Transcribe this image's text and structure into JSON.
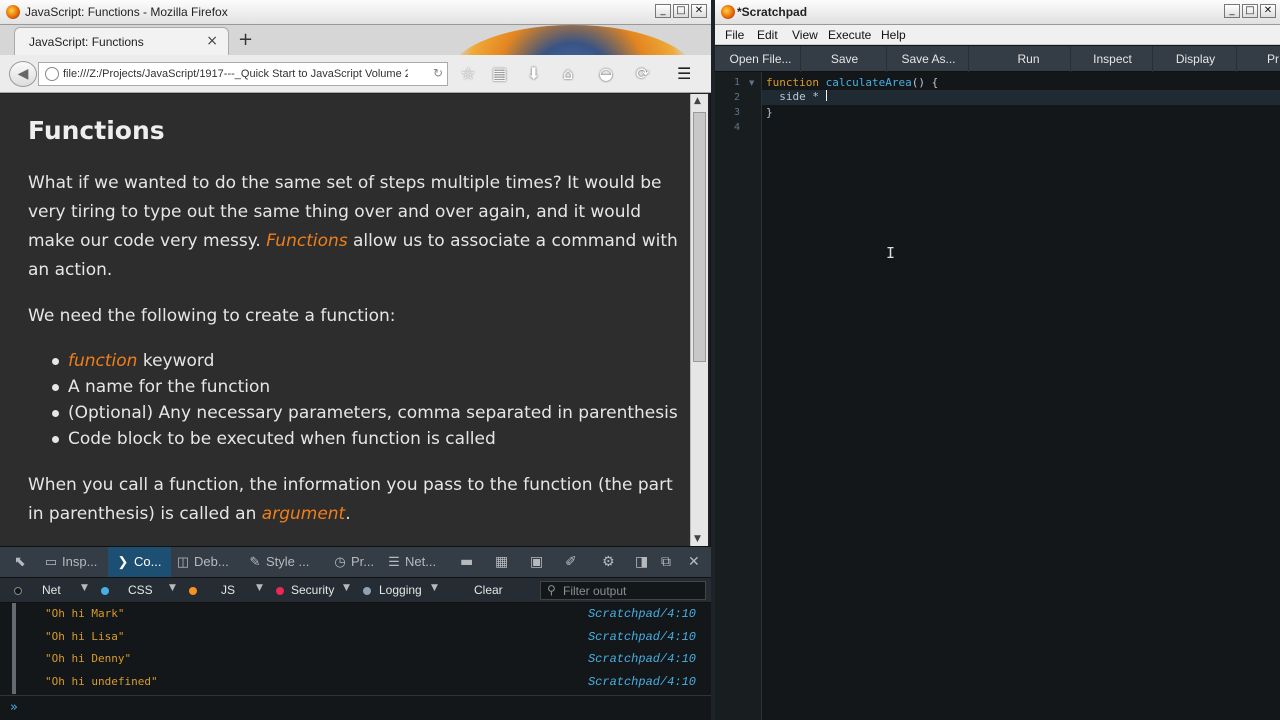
{
  "firefox": {
    "title": "JavaScript: Functions - Mozilla Firefox",
    "tab_label": "JavaScript: Functions",
    "tab_close": "×",
    "new_tab": "+",
    "url": "file:///Z:/Projects/JavaScript/1917---_Quick Start to JavaScript Volume 2",
    "win_min": "_",
    "win_max": "□",
    "win_close": "✕"
  },
  "content": {
    "heading": "Functions",
    "p1_a": "What if we wanted to do the same set of steps multiple times? It would be very tiring to type out the same thing over and over again, and it would make our code very messy. ",
    "p1_hl": "Functions",
    "p1_b": " allow us to associate a command with an action.",
    "p2": "We need the following to create a function:",
    "bullet1_hl": "function",
    "bullet1_rest": " keyword",
    "bullet2": "A name for the function",
    "bullet3": "(Optional) Any necessary parameters, comma separated in parenthesis",
    "bullet4": "Code block to be executed when function is called",
    "p3_a": "When you call a function, the information you pass to the function (the part in parenthesis) is called an ",
    "p3_hl": "argument",
    "p3_b": "."
  },
  "devtools": {
    "tabs": [
      "Insp...",
      "Co...",
      "Deb...",
      "Style ...",
      "Pr...",
      "Net..."
    ],
    "filters": {
      "net": "Net",
      "css": "CSS",
      "js": "JS",
      "security": "Security",
      "logging": "Logging",
      "clear": "Clear",
      "filter_placeholder": "Filter output"
    },
    "log": [
      {
        "msg": "\"Oh hi Mark\"",
        "src": "Scratchpad/4:10"
      },
      {
        "msg": "\"Oh hi Lisa\"",
        "src": "Scratchpad/4:10"
      },
      {
        "msg": "\"Oh hi Denny\"",
        "src": "Scratchpad/4:10"
      },
      {
        "msg": "\"Oh hi undefined\"",
        "src": "Scratchpad/4:10"
      }
    ],
    "prompt": "»"
  },
  "scratchpad": {
    "title": "*Scratchpad",
    "menu": [
      "File",
      "Edit",
      "View",
      "Execute",
      "Help"
    ],
    "toolbar": [
      "Open File...",
      "Save",
      "Save As...",
      "Run",
      "Inspect",
      "Display",
      "Pr"
    ],
    "line_numbers": [
      "1",
      "2",
      "3",
      "4"
    ],
    "code": {
      "l1_kw": "function",
      "l1_fn": "calculateArea",
      "l1_rest": "() {",
      "l2": "  side * ",
      "l3": "}"
    }
  },
  "colors": {
    "accent_orange": "#f07e1a",
    "devtools_blue": "#46afe3",
    "log_string": "#d99b28"
  }
}
